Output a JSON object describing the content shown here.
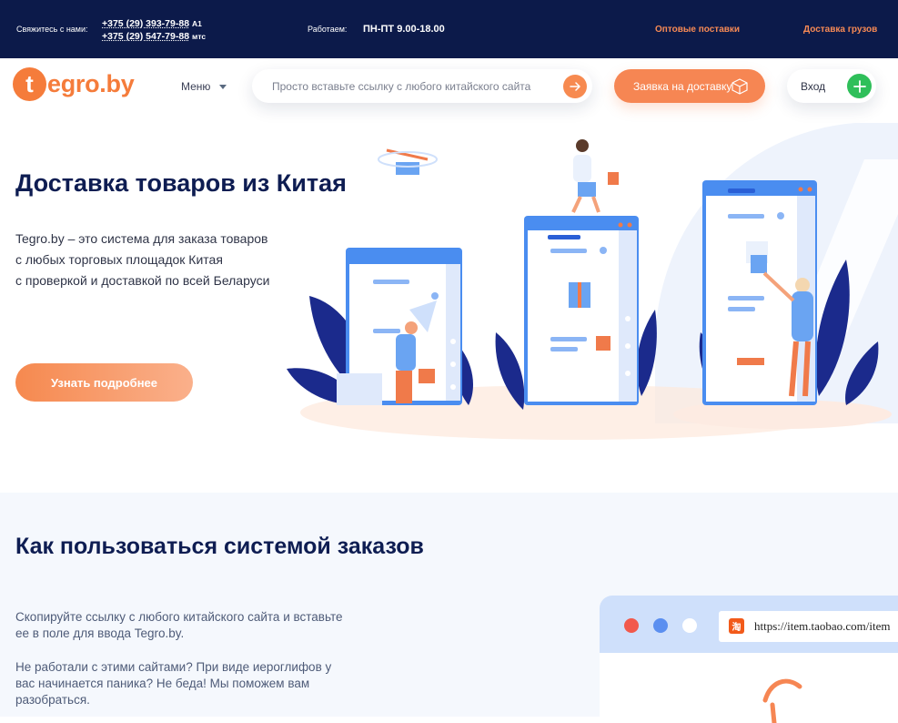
{
  "topbar": {
    "contact_label": "Свяжитесь с нами:",
    "phones": [
      {
        "number": "+375 (29) 393-79-88",
        "operator": "A1"
      },
      {
        "number": "+375 (29) 547-79-88",
        "operator": "мтс"
      }
    ],
    "work_label": "Работаем:",
    "hours": "ПН-ПТ 9.00-18.00",
    "links": [
      "Оптовые поставки",
      "Доставка грузов"
    ]
  },
  "header": {
    "logo_letter": "t",
    "logo_text": "egro.by",
    "menu_label": "Меню",
    "search_placeholder": "Просто вставьте ссылку с любого китайского сайта",
    "order_button": "Заявка на доставку",
    "login_label": "Вход"
  },
  "hero": {
    "title": "Доставка товаров из Китая",
    "text_lines": [
      "Tegro.by – это система для заказа товаров",
      "с любых торговых площадок Китая",
      "с проверкой и доставкой по всей Беларуси"
    ],
    "button": "Узнать подробнее"
  },
  "howto": {
    "title": "Как пользоваться системой заказов",
    "p1": "Скопируйте ссылку с любого китайского сайта  и вставьте ее в поле для ввода Tegro.by.",
    "p2": "Не работали с этими сайтами? При виде иероглифов у вас начинается паника? Не беда! Мы поможем вам разобраться.",
    "browser_url": "https://item.taobao.com/item",
    "browser_icon_glyph": "淘"
  },
  "colors": {
    "navy": "#0c1a4a",
    "accent_orange": "#f68653",
    "green": "#2fbf5a",
    "light_blue": "#cfe0fb"
  }
}
